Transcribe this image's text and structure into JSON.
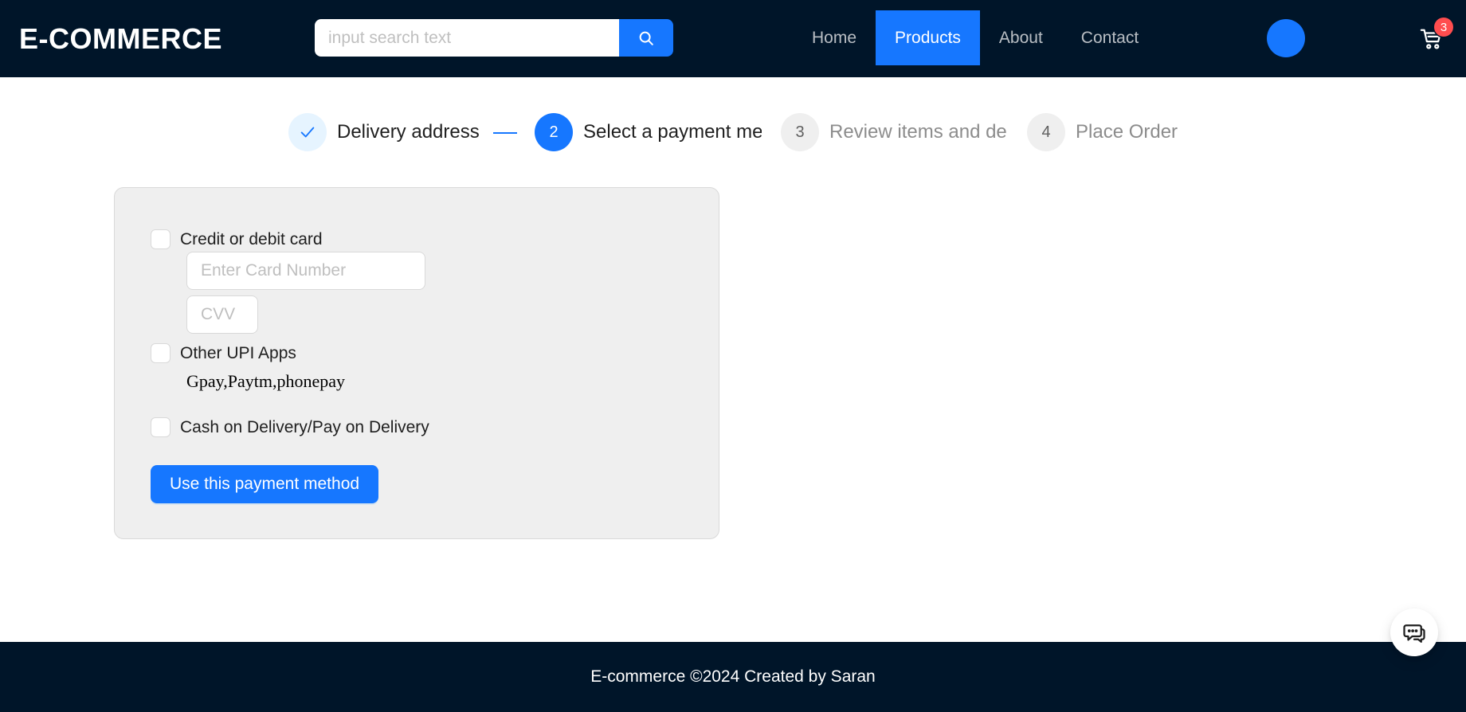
{
  "header": {
    "logo": "E-COMMERCE",
    "search": {
      "placeholder": "input search text",
      "icon": "search-icon"
    },
    "nav": [
      {
        "label": "Home",
        "active": false
      },
      {
        "label": "Products",
        "active": true
      },
      {
        "label": "About",
        "active": false
      },
      {
        "label": "Contact",
        "active": false
      }
    ],
    "cart": {
      "icon": "cart-icon",
      "count": "3"
    },
    "colors": {
      "background": "#001529",
      "accent": "#1677ff",
      "badge": "#ff4d4f"
    }
  },
  "steps": [
    {
      "title": "Delivery address",
      "status": "finished",
      "icon": "check-icon"
    },
    {
      "number": "2",
      "title": "Select a payment method",
      "status": "current"
    },
    {
      "number": "3",
      "title": "Review items and delivery",
      "status": "waiting"
    },
    {
      "number": "4",
      "title": "Place Order",
      "status": "waiting"
    }
  ],
  "payment": {
    "options": [
      {
        "label": "Credit or debit card",
        "checked": false
      },
      {
        "label": "Other UPI Apps",
        "checked": false
      },
      {
        "label": "Cash on Delivery/Pay on Delivery",
        "checked": false
      }
    ],
    "card_number": {
      "placeholder": "Enter Card Number",
      "value": ""
    },
    "cvv": {
      "placeholder": "CVV",
      "value": ""
    },
    "upi_apps_text": "Gpay,Paytm,phonepay",
    "submit_label": "Use this payment method"
  },
  "chat": {
    "icon": "chat-icon"
  },
  "footer": {
    "text": "E-commerce ©2024 Created by Saran"
  }
}
